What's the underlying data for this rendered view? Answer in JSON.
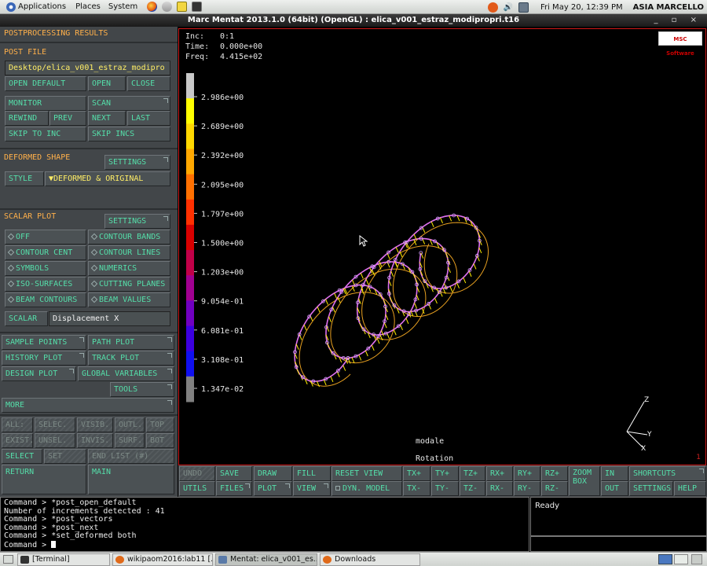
{
  "top_panel": {
    "applications": "Applications",
    "places": "Places",
    "system": "System",
    "datetime": "Fri May 20, 12:39 PM",
    "user": "ASIA MARCELLO"
  },
  "window": {
    "title": "Marc Mentat 2013.1.0 (64bit) (OpenGL) : elica_v001_estraz_modipropri.t16",
    "controls": "_ ▫ ×"
  },
  "left": {
    "postprocessing_results": "POSTPROCESSING RESULTS",
    "post_file_label": "POST FILE",
    "post_file_path": "Desktop/elica_v001_estraz_modipro",
    "open_default": "OPEN DEFAULT",
    "open": "OPEN",
    "close": "CLOSE",
    "monitor": "MONITOR",
    "scan": "SCAN",
    "rewind": "REWIND",
    "prev": "PREV",
    "next": "NEXT",
    "last": "LAST",
    "skip_to_inc": "SKIP TO INC",
    "skip_incs": "SKIP INCS",
    "deformed_shape": "DEFORMED SHAPE",
    "settings": "SETTINGS",
    "style": "STYLE",
    "style_value": "▼DEFORMED & ORIGINAL",
    "scalar_plot": "SCALAR PLOT",
    "off": "OFF",
    "contour_bands": "CONTOUR BANDS",
    "contour_cent": "CONTOUR CENT",
    "contour_lines": "CONTOUR LINES",
    "symbols": "SYMBOLS",
    "numerics": "NUMERICS",
    "iso_surfaces": "ISO-SURFACES",
    "cutting_planes": "CUTTING PLANES",
    "beam_contours": "BEAM CONTOURS",
    "beam_values": "BEAM VALUES",
    "scalar": "SCALAR",
    "scalar_value": "Displacement X",
    "sample_points": "SAMPLE POINTS",
    "path_plot": "PATH PLOT",
    "history_plot": "HISTORY PLOT",
    "track_plot": "TRACK PLOT",
    "design_plot": "DESIGN PLOT",
    "global_variables": "GLOBAL VARIABLES",
    "tools": "TOOLS",
    "more": "MORE",
    "all": "ALL:",
    "selec": "SELEC.",
    "visib": "VISIB.",
    "outl": "OUTL.",
    "top": "TOP",
    "exist": "EXIST.",
    "unsel": "UNSEL.",
    "invis": "INVIS.",
    "surf": "SURF.",
    "bot": "BOT",
    "select": "SELECT",
    "set": "SET",
    "end_list": "END LIST (#)",
    "return": "RETURN",
    "main": "MAIN"
  },
  "viewport": {
    "inc_label": "Inc:",
    "inc_value": "0:1",
    "time_label": "Time:",
    "time_value": "0.000e+00",
    "freq_label": "Freq:",
    "freq_value": "4.415e+02",
    "msc_logo": "MSC Software",
    "legend": [
      "2.986e+00",
      "2.689e+00",
      "2.392e+00",
      "2.095e+00",
      "1.797e+00",
      "1.500e+00",
      "1.203e+00",
      "9.054e-01",
      "6.081e-01",
      "3.108e-01",
      "1.347e-02"
    ],
    "legend_colors": [
      "#c8c8c8",
      "#ffff00",
      "#ffd800",
      "#ffa800",
      "#ff7000",
      "#ff3000",
      "#d80000",
      "#c00048",
      "#a00090",
      "#7000c0",
      "#3c00e0",
      "#1010f0",
      "#808080"
    ],
    "job": "modale",
    "mode": "Rotation",
    "axis_x": "X",
    "axis_y": "Y",
    "axis_z": "Z",
    "corner_num": "1"
  },
  "toolbar": {
    "undo": "UNDO",
    "save": "SAVE",
    "draw": "DRAW",
    "fill": "FILL",
    "reset_view": "RESET VIEW",
    "tx_plus": "TX+",
    "ty_plus": "TY+",
    "tz_plus": "TZ+",
    "rx_plus": "RX+",
    "ry_plus": "RY+",
    "rz_plus": "RZ+",
    "zoom_box": "ZOOM BOX",
    "in": "IN",
    "shortcuts": "SHORTCUTS",
    "utils": "UTILS",
    "files": "FILES",
    "plot": "PLOT",
    "view": "VIEW",
    "dyn_model": "DYN. MODEL",
    "tx_minus": "TX-",
    "ty_minus": "TY-",
    "tz_minus": "TZ-",
    "rx_minus": "RX-",
    "ry_minus": "RY-",
    "rz_minus": "RZ-",
    "out": "OUT",
    "settings": "SETTINGS",
    "help": "HELP"
  },
  "command": {
    "lines": [
      "Command > *post_open_default",
      "Number of increments detected : 41",
      "Command > *post_vectors",
      "Command > *post_next",
      "Command > *set_deformed both"
    ],
    "prompt": "Command > "
  },
  "status": {
    "text": "Ready"
  },
  "taskbar": {
    "terminal": "[Terminal]",
    "browser": "wikipaom2016:lab11 [...",
    "mentat": "Mentat: elica_v001_es...",
    "downloads": "Downloads"
  }
}
